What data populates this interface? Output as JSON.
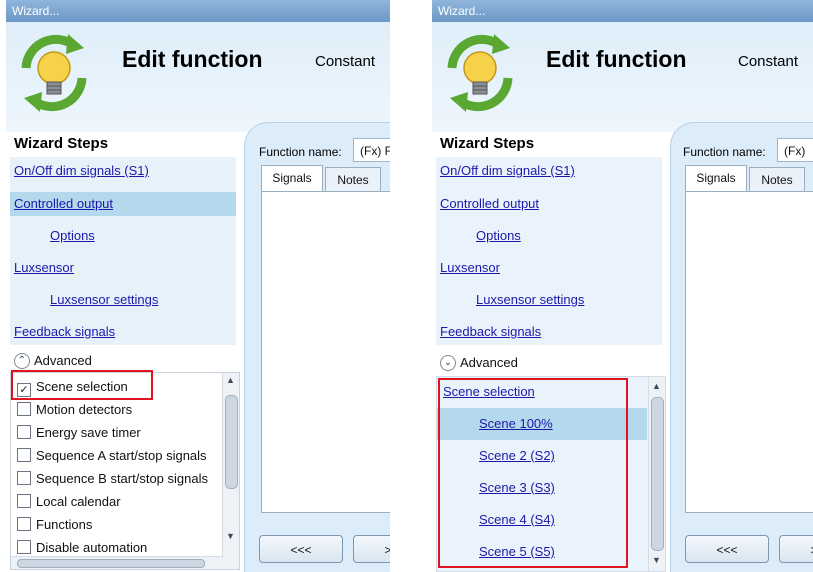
{
  "window_title": "Wizard...",
  "header": {
    "title": "Edit function",
    "subtitle": "Constant"
  },
  "wizard_steps": {
    "title": "Wizard Steps",
    "items": [
      "On/Off dim signals (S1)",
      "Controlled output",
      "Options",
      "Luxsensor",
      "Luxsensor settings",
      "Feedback signals"
    ]
  },
  "advanced": {
    "label": "Advanced"
  },
  "options_list": [
    {
      "label": "Scene selection",
      "checked": true
    },
    {
      "label": "Motion detectors",
      "checked": false
    },
    {
      "label": "Energy save timer",
      "checked": false
    },
    {
      "label": "Sequence A start/stop signals",
      "checked": false
    },
    {
      "label": "Sequence B start/stop signals",
      "checked": false
    },
    {
      "label": "Local calendar",
      "checked": false
    },
    {
      "label": "Functions",
      "checked": false
    },
    {
      "label": "Disable automation",
      "checked": false
    }
  ],
  "scene_list": {
    "header": "Scene selection",
    "items": [
      "Scene 100%",
      "Scene 2 (S2)",
      "Scene 3 (S3)",
      "Scene 4 (S4)",
      "Scene 5 (S5)"
    ]
  },
  "function_name": {
    "label": "Function name:",
    "value_left": "(Fx) F",
    "value_right": "(Fx)"
  },
  "tabs": {
    "signals": "Signals",
    "notes": "Notes"
  },
  "nav": {
    "prev": "<<<",
    "next_left": ">",
    "next_right": ">"
  },
  "colors": {
    "highlight": "#e0141e",
    "link": "#1a1aaa",
    "selected_row": "#b4d8ec",
    "titlebar": "#7aa3ce"
  }
}
